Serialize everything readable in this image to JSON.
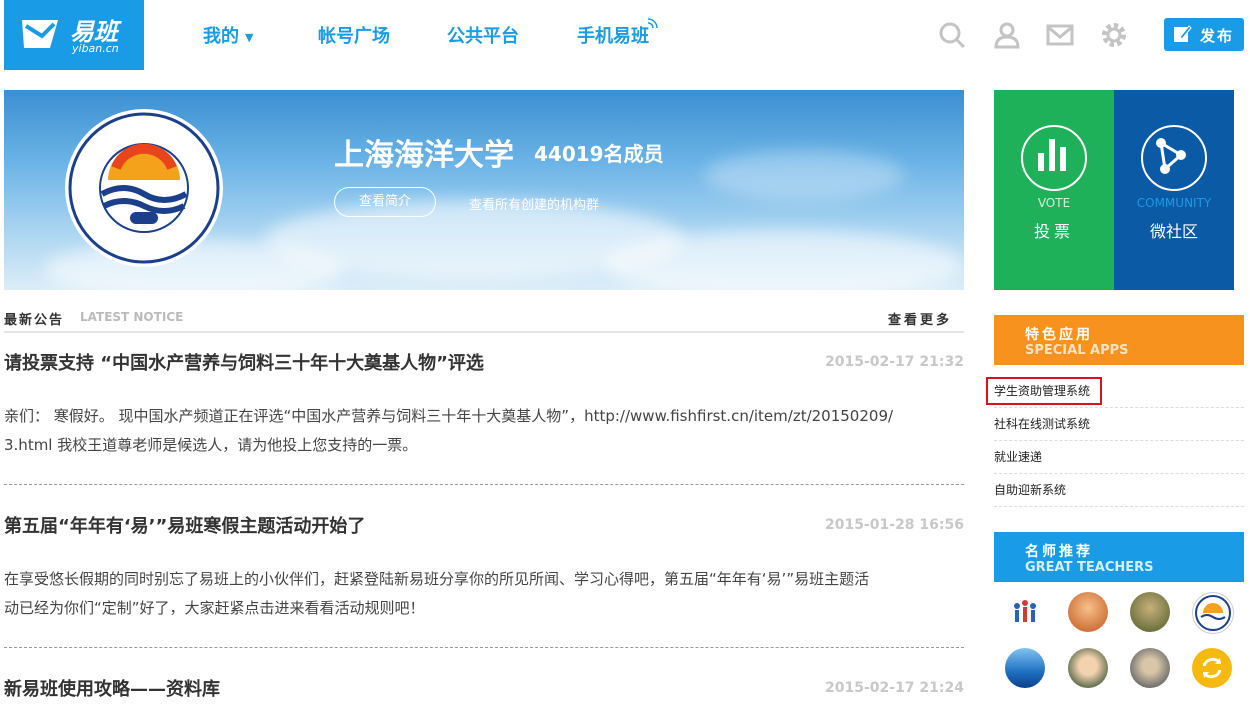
{
  "header": {
    "logo_cn": "易班",
    "logo_en": "yiban.cn",
    "nav": [
      "我的",
      "帐号广场",
      "公共平台",
      "手机易班"
    ],
    "publish_label": "发布"
  },
  "banner": {
    "university": "上海海洋大学",
    "members": "44019名成员",
    "intro_btn": "查看简介",
    "all_orgs": "查看所有创建的机构群"
  },
  "notice": {
    "title_cn": "最新公告",
    "title_en": "LATEST NOTICE",
    "more": "查看更多",
    "posts": [
      {
        "title": "请投票支持 “中国水产营养与饲料三十年十大奠基人物”评选",
        "date": "2015-02-17 21:32",
        "body1": "亲们： 寒假好。 现中国水产频道正在评选“中国水产营养与饲料三十年十大奠基人物”，http://www.fishfirst.cn/item/zt/20150209/",
        "body2": "3.html 我校王道尊老师是候选人，请为他投上您支持的一票。"
      },
      {
        "title": "第五届“年年有‘易’”易班寒假主题活动开始了",
        "date": "2015-01-28 16:56",
        "body1": "在享受悠长假期的同时别忘了易班上的小伙伴们，赶紧登陆新易班分享你的所见所闻、学习心得吧，第五届“年年有‘易’”易班主题活",
        "body2": "动已经为你们“定制”好了，大家赶紧点击进来看看活动规则吧！"
      },
      {
        "title": "新易班使用攻略——资料库",
        "date": "2015-02-17 21:24"
      }
    ]
  },
  "side": {
    "vote_en": "VOTE",
    "vote_cn": "投票",
    "community_en": "COMMUNITY",
    "community_cn": "微社区",
    "apps_cn": "特色应用",
    "apps_en": "SPECIAL APPS",
    "apps": [
      "学生资助管理系统",
      "社科在线测试系统",
      "就业速递",
      "自助迎新系统"
    ],
    "teachers_cn": "名师推荐",
    "teachers_en": "GREAT TEACHERS"
  },
  "colors": {
    "brand": "#1a9be6",
    "vote_tile": "#1eb15a",
    "community_tile": "#0b5aa5",
    "apps_header": "#f7921e",
    "highlight": "#d9121b"
  }
}
